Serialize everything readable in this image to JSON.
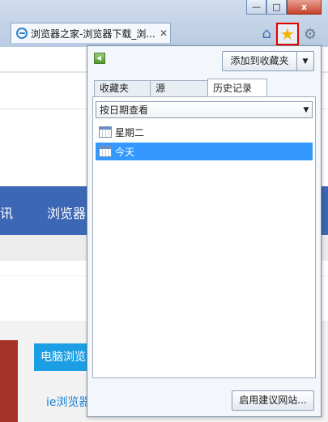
{
  "window": {
    "minimize_label": "—",
    "restore_label": "□",
    "close_label": "x"
  },
  "tab": {
    "title": "浏览器之家-浏览器下载_浏...",
    "close_label": "✕"
  },
  "page": {
    "nav_item_1": "讯",
    "nav_item_2": "浏览器",
    "blue_button": "电脑浏览",
    "blue_link": "ie浏览器"
  },
  "favorites_pane": {
    "add_button_label": "添加到收藏夹",
    "add_button_arrow": "▼",
    "tabs": [
      {
        "label": "收藏夹"
      },
      {
        "label": "源"
      },
      {
        "label": "历史记录"
      }
    ],
    "view_select": {
      "value": "按日期查看",
      "arrow": "▼"
    },
    "history_items": [
      {
        "label": "星期二",
        "selected": false
      },
      {
        "label": "今天",
        "selected": true
      }
    ],
    "suggest_button_label": "启用建议网站..."
  },
  "colors": {
    "selection": "#3399ff",
    "highlight_box": "#e00000",
    "favorites_star": "#f2b400",
    "nav_bar": "#3c67b5"
  }
}
